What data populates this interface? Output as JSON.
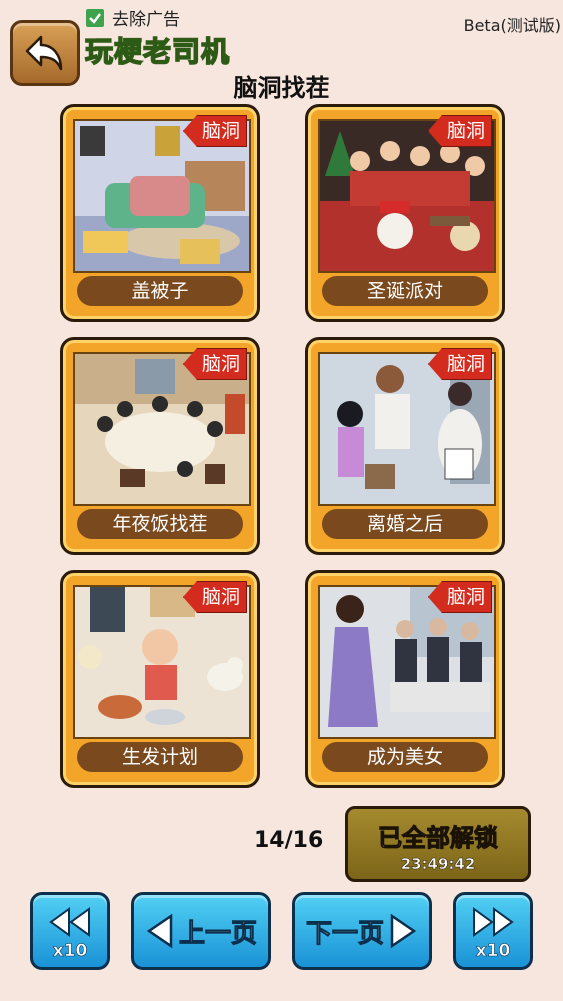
{
  "header": {
    "ad_remove_label": "去除广告",
    "logo_text": "玩梗老司机",
    "beta_label": "Beta(测试版)",
    "title": "脑洞找茬"
  },
  "levels": [
    {
      "label": "盖被子",
      "tag": "脑洞"
    },
    {
      "label": "圣诞派对",
      "tag": "脑洞"
    },
    {
      "label": "年夜饭找茬",
      "tag": "脑洞"
    },
    {
      "label": "离婚之后",
      "tag": "脑洞"
    },
    {
      "label": "生发计划",
      "tag": "脑洞"
    },
    {
      "label": "成为美女",
      "tag": "脑洞"
    }
  ],
  "footer": {
    "page_counter": "14/16",
    "unlock_label": "已全部解锁",
    "unlock_timer": "23:49:42",
    "prev_label": "上一页",
    "next_label": "下一页",
    "jump_label": "x10"
  },
  "colors": {
    "background": "#f6e6de",
    "card": "#f3a529",
    "tag": "#d42b1f",
    "nav": "#1a92d6"
  }
}
